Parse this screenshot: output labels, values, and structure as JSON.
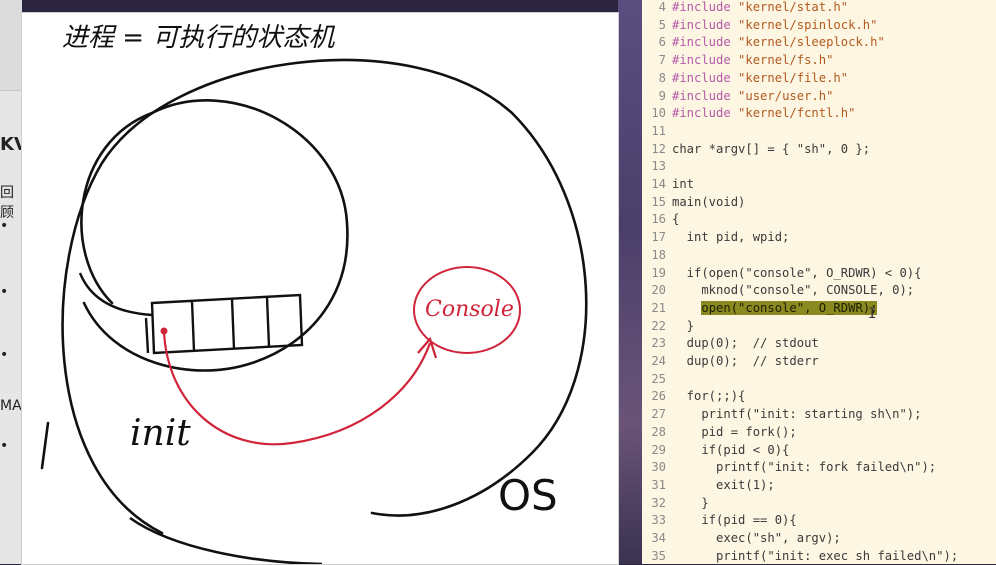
{
  "left_window": {
    "stubs": [
      {
        "id": "kv",
        "text": "KV"
      },
      {
        "id": "hui",
        "text": "回顾"
      },
      {
        "id": "b1",
        "text": "•"
      },
      {
        "id": "b2",
        "text": "•"
      },
      {
        "id": "b3",
        "text": "•"
      },
      {
        "id": "ma",
        "text": "MA"
      },
      {
        "id": "b4",
        "text": "•"
      }
    ]
  },
  "whiteboard": {
    "title": "进程 = 可执行的状态机",
    "labels": {
      "init": "init",
      "console": "Console",
      "os": "OS"
    },
    "colors": {
      "ink": "#111111",
      "red": "#d0243a"
    }
  },
  "editor": {
    "lines": [
      {
        "n": "4",
        "text": "#include \"kernel/stat.h\""
      },
      {
        "n": "5",
        "text": "#include \"kernel/spinlock.h\""
      },
      {
        "n": "6",
        "text": "#include \"kernel/sleeplock.h\""
      },
      {
        "n": "7",
        "text": "#include \"kernel/fs.h\""
      },
      {
        "n": "8",
        "text": "#include \"kernel/file.h\""
      },
      {
        "n": "9",
        "text": "#include \"user/user.h\""
      },
      {
        "n": "10",
        "text": "#include \"kernel/fcntl.h\""
      },
      {
        "n": "11",
        "text": ""
      },
      {
        "n": "12",
        "text": "char *argv[] = { \"sh\", 0 };"
      },
      {
        "n": "13",
        "text": ""
      },
      {
        "n": "14",
        "text": "int"
      },
      {
        "n": "15",
        "text": "main(void)"
      },
      {
        "n": "16",
        "text": "{"
      },
      {
        "n": "17",
        "text": "  int pid, wpid;"
      },
      {
        "n": "18",
        "text": ""
      },
      {
        "n": "19",
        "text": "  if(open(\"console\", O_RDWR) < 0){"
      },
      {
        "n": "20",
        "text": "    mknod(\"console\", CONSOLE, 0);"
      },
      {
        "n": "21",
        "text": "    open(\"console\", O_RDWR);"
      },
      {
        "n": "22",
        "text": "  }"
      },
      {
        "n": "23",
        "text": "  dup(0);  // stdout"
      },
      {
        "n": "24",
        "text": "  dup(0);  // stderr"
      },
      {
        "n": "25",
        "text": ""
      },
      {
        "n": "26",
        "text": "  for(;;){"
      },
      {
        "n": "27",
        "text": "    printf(\"init: starting sh\\n\");"
      },
      {
        "n": "28",
        "text": "    pid = fork();"
      },
      {
        "n": "29",
        "text": "    if(pid < 0){"
      },
      {
        "n": "30",
        "text": "      printf(\"init: fork failed\\n\");"
      },
      {
        "n": "31",
        "text": "      exit(1);"
      },
      {
        "n": "32",
        "text": "    }"
      },
      {
        "n": "33",
        "text": "    if(pid == 0){"
      },
      {
        "n": "34",
        "text": "      exec(\"sh\", argv);"
      },
      {
        "n": "35",
        "text": "      printf(\"init: exec sh failed\\n\");"
      }
    ],
    "highlighted_line": "21",
    "colors": {
      "background": "#fdf6e3",
      "highlight": "#8a8a20",
      "linenum": "#8a8a8a"
    }
  }
}
